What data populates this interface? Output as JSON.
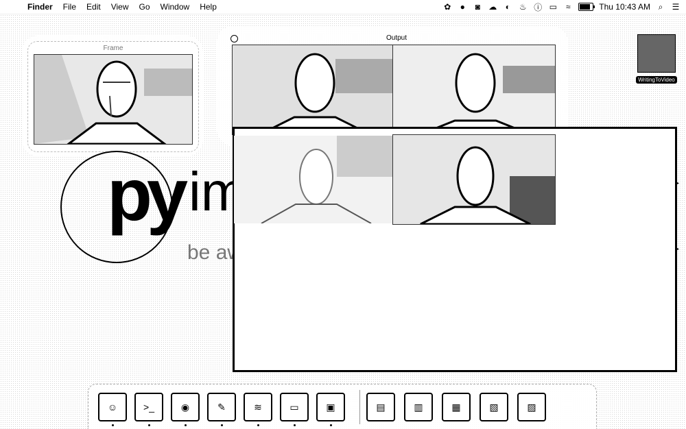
{
  "menubar": {
    "apple_icon": "apple-icon",
    "items": [
      "Finder",
      "File",
      "Edit",
      "View",
      "Go",
      "Window",
      "Help"
    ],
    "status_icons": [
      "dropbox-icon",
      "circle-icon",
      "frame-icon",
      "cloud-icon",
      "creative-icon",
      "flame-icon",
      "info-icon",
      "display-icon",
      "wifi-icon"
    ],
    "battery_level": 0.85,
    "clock": "Thu 10:43 AM",
    "search_icon": "search-icon",
    "list_icon": "list-icon"
  },
  "frame_window": {
    "title": "Frame"
  },
  "output_window": {
    "title": "Output"
  },
  "logo": {
    "main_a": "py",
    "main_b": "im",
    "subtitle": "be aweso"
  },
  "desktop": {
    "icon_label": "WritingToVideo"
  },
  "dock": {
    "items": [
      {
        "name": "finder",
        "glyph": "☺"
      },
      {
        "name": "terminal",
        "glyph": ">_"
      },
      {
        "name": "chrome",
        "glyph": "◉"
      },
      {
        "name": "pencil",
        "glyph": "✎"
      },
      {
        "name": "spotify",
        "glyph": "≋"
      },
      {
        "name": "photo",
        "glyph": "▭"
      },
      {
        "name": "window",
        "glyph": "▣"
      },
      {
        "name": "doc1",
        "glyph": "▤"
      },
      {
        "name": "doc2",
        "glyph": "▥"
      },
      {
        "name": "doc3",
        "glyph": "▦"
      },
      {
        "name": "doc4",
        "glyph": "▧"
      },
      {
        "name": "doc5",
        "glyph": "▨"
      }
    ]
  },
  "colors": {
    "line": "#000000",
    "page": "#ffffff"
  }
}
